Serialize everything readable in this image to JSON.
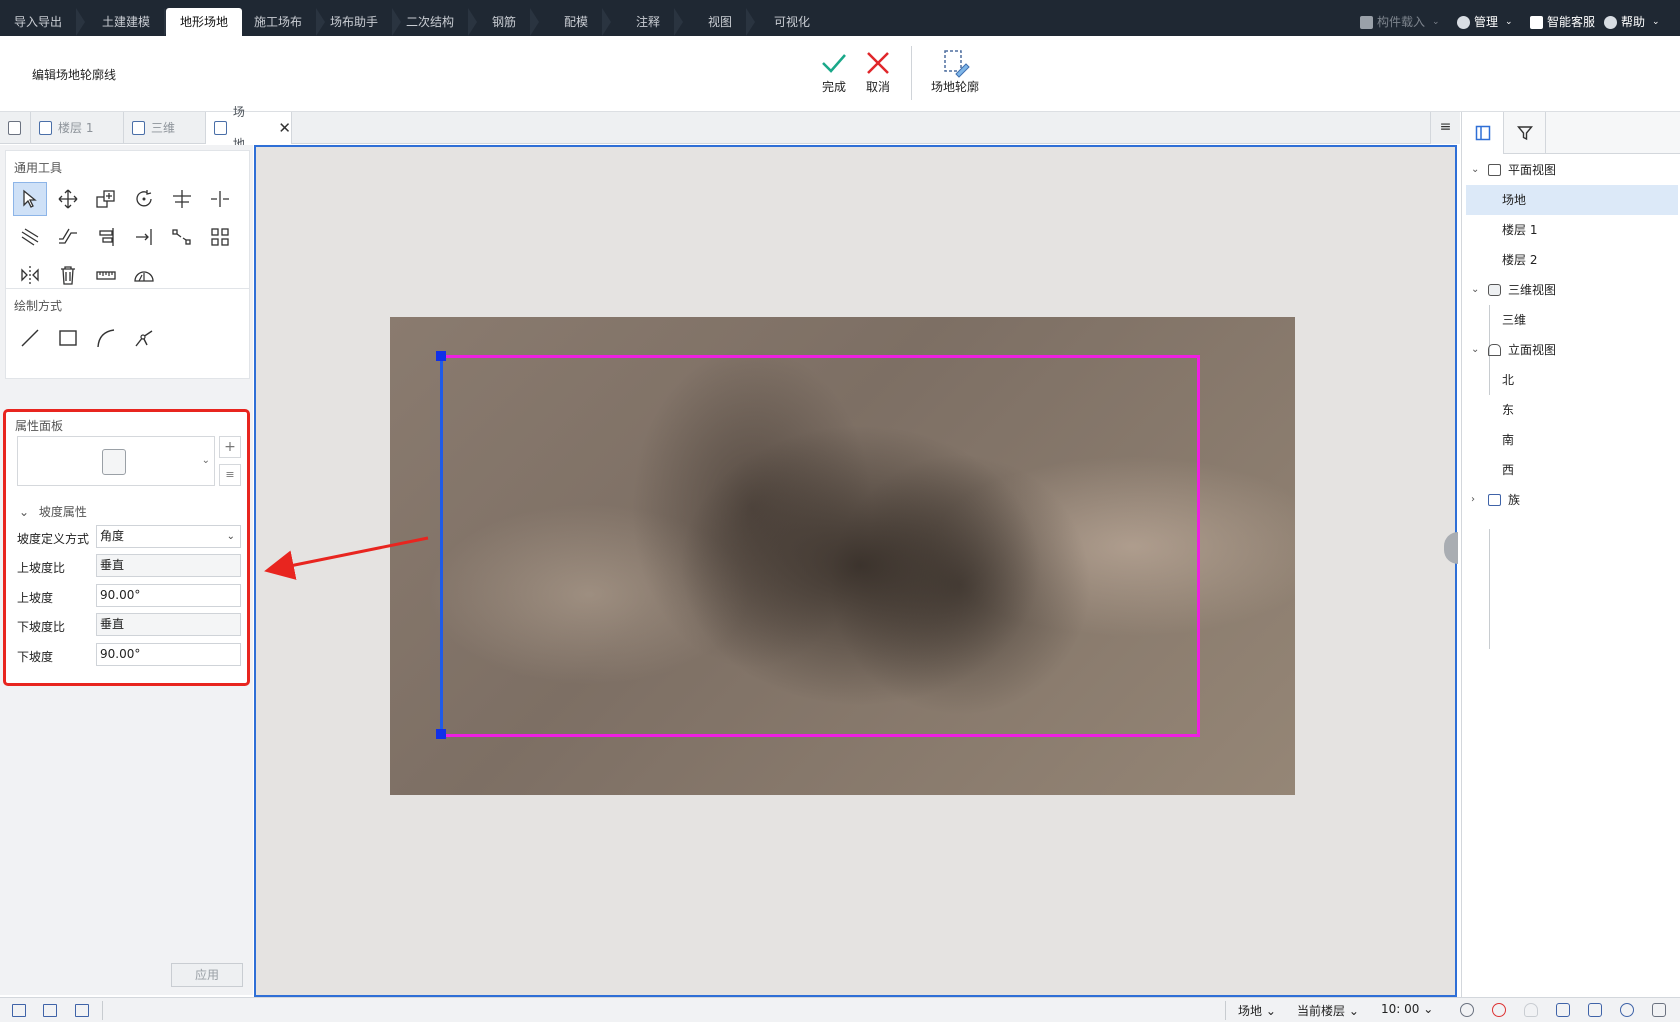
{
  "menu": {
    "tabs": [
      "导入导出",
      "土建建模",
      "地形场地",
      "施工场布",
      "场布助手",
      "二次结构",
      "钢筋",
      "配模",
      "注释",
      "视图",
      "可视化"
    ],
    "active_index": 2,
    "right": {
      "component_load": "构件载入",
      "manage": "管理",
      "support": "智能客服",
      "help": "帮助"
    }
  },
  "ribbon": {
    "title": "编辑场地轮廓线",
    "finish": "完成",
    "cancel": "取消",
    "site_outline": "场地轮廓"
  },
  "doc_tabs": {
    "floor1": "楼层 1",
    "three_d": "三维",
    "site": "场地"
  },
  "left_panel": {
    "general_tools_title": "通用工具",
    "draw_mode_title": "绘制方式",
    "property_panel_title": "属性面板",
    "slope_group": "坡度属性",
    "rows": {
      "slope_def_label": "坡度定义方式",
      "slope_def_value": "角度",
      "upper_ratio_label": "上坡度比",
      "upper_ratio_value": "垂直",
      "upper_slope_label": "上坡度",
      "upper_slope_value": "90.00°",
      "lower_ratio_label": "下坡度比",
      "lower_ratio_value": "垂直",
      "lower_slope_label": "下坡度",
      "lower_slope_value": "90.00°"
    },
    "apply": "应用"
  },
  "tree": {
    "plan_view": "平面视图",
    "site": "场地",
    "floor1": "楼层 1",
    "floor2": "楼层 2",
    "view_3d": "三维视图",
    "three_d": "三维",
    "elevation": "立面视图",
    "north": "北",
    "east": "东",
    "south": "南",
    "west": "西",
    "family": "族"
  },
  "status": {
    "view": "场地",
    "floor_scope": "当前楼层",
    "scale": "10: 00"
  },
  "colors": {
    "boundary_magenta": "#ee1fe2",
    "boundary_blue_edge": "#1f5be8",
    "highlight_red": "#e8251f",
    "canvas_border": "#2f6fd6"
  }
}
